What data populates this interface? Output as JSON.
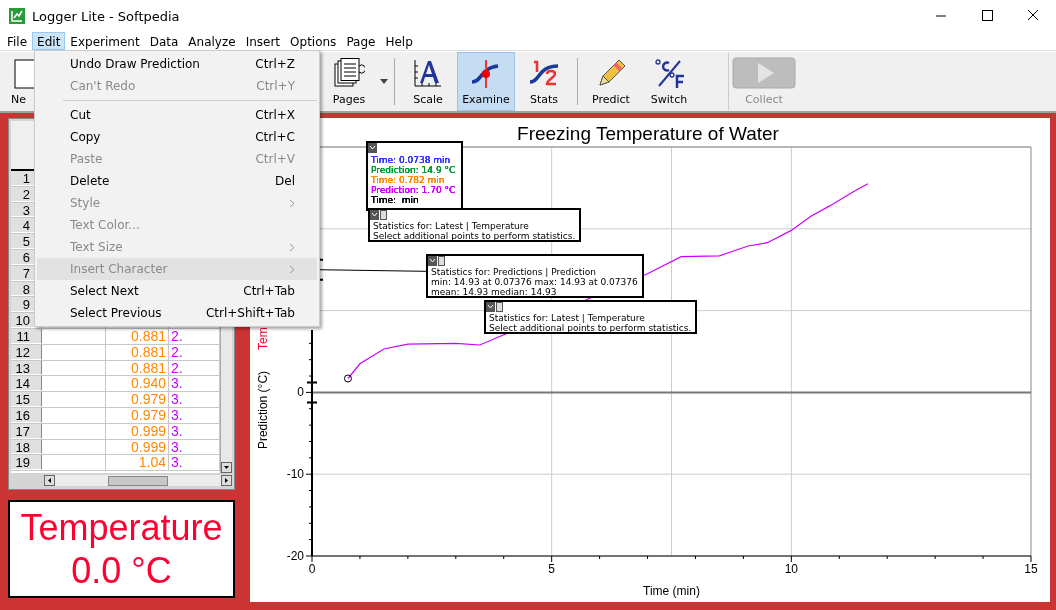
{
  "window": {
    "title": "Logger Lite - Softpedia"
  },
  "menu_bar": [
    {
      "label": "File",
      "selected": false
    },
    {
      "label": "Edit",
      "selected": true
    },
    {
      "label": "Experiment",
      "selected": false
    },
    {
      "label": "Data",
      "selected": false
    },
    {
      "label": "Analyze",
      "selected": false
    },
    {
      "label": "Insert",
      "selected": false
    },
    {
      "label": "Options",
      "selected": false
    },
    {
      "label": "Page",
      "selected": false
    },
    {
      "label": "Help",
      "selected": false
    }
  ],
  "toolbar": [
    {
      "label": "Ne",
      "kind": "new",
      "selected": false,
      "disabled": false
    },
    {
      "label": "Pages",
      "kind": "pages",
      "selected": false,
      "disabled": false
    },
    {
      "label": "Scale",
      "kind": "scale",
      "selected": false,
      "disabled": false
    },
    {
      "label": "Examine",
      "kind": "examine",
      "selected": true,
      "disabled": false
    },
    {
      "label": "Stats",
      "kind": "stats",
      "selected": false,
      "disabled": false
    },
    {
      "label": "Predict",
      "kind": "predict",
      "selected": false,
      "disabled": false
    },
    {
      "label": "Switch",
      "kind": "switch",
      "selected": false,
      "disabled": false
    },
    {
      "label": "Collect",
      "kind": "collect",
      "selected": false,
      "disabled": true
    }
  ],
  "edit_menu": [
    {
      "label": "Undo Draw Prediction",
      "shortcut": "Ctrl+Z",
      "disabled": false,
      "submenu": false,
      "highlighted": false
    },
    {
      "label": "Can't Redo",
      "shortcut": "Ctrl+Y",
      "disabled": true,
      "submenu": false,
      "highlighted": false,
      "separator_after": true
    },
    {
      "label": "Cut",
      "shortcut": "Ctrl+X",
      "disabled": false,
      "submenu": false,
      "highlighted": false
    },
    {
      "label": "Copy",
      "shortcut": "Ctrl+C",
      "disabled": false,
      "submenu": false,
      "highlighted": false
    },
    {
      "label": "Paste",
      "shortcut": "Ctrl+V",
      "disabled": true,
      "submenu": false,
      "highlighted": false
    },
    {
      "label": "Delete",
      "shortcut": "Del",
      "disabled": false,
      "submenu": false,
      "highlighted": false
    },
    {
      "label": "Style",
      "disabled": true,
      "submenu": true,
      "highlighted": false
    },
    {
      "label": "Text Color...",
      "disabled": true,
      "submenu": false,
      "highlighted": false
    },
    {
      "label": "Text Size",
      "disabled": true,
      "submenu": true,
      "highlighted": false
    },
    {
      "label": "Insert Character",
      "disabled": true,
      "submenu": true,
      "highlighted": true
    },
    {
      "label": "Select Next",
      "shortcut": "Ctrl+Tab",
      "disabled": false,
      "submenu": false,
      "highlighted": false
    },
    {
      "label": "Select Previous",
      "shortcut": "Ctrl+Shift+Tab",
      "disabled": false,
      "submenu": false,
      "highlighted": false
    }
  ],
  "table": {
    "rows": [
      {
        "number": "1"
      },
      {
        "number": "2"
      },
      {
        "number": "3"
      },
      {
        "number": "4"
      },
      {
        "number": "5"
      },
      {
        "number": "6"
      },
      {
        "number": "7"
      },
      {
        "number": "8"
      },
      {
        "number": "9"
      },
      {
        "number": "10"
      },
      {
        "number": "11",
        "column_2": "0.881",
        "column_3": "2."
      },
      {
        "number": "12",
        "column_2": "0.881",
        "column_3": "2."
      },
      {
        "number": "13",
        "column_2": "0.881",
        "column_3": "2."
      },
      {
        "number": "14",
        "column_2": "0.940",
        "column_3": "3."
      },
      {
        "number": "15",
        "column_2": "0.979",
        "column_3": "3."
      },
      {
        "number": "16",
        "column_2": "0.979",
        "column_3": "3."
      },
      {
        "number": "17",
        "column_2": "0.999",
        "column_3": "3."
      },
      {
        "number": "18",
        "column_2": "0.999",
        "column_3": "3."
      },
      {
        "number": "19",
        "column_2": "1.04",
        "column_3": "3."
      }
    ]
  },
  "meter": {
    "label": "Temperature",
    "reading": "0.0 °C"
  },
  "graph": {
    "y_label_cut": "Tem",
    "chart_data": {
      "type": "line",
      "title": "Freezing Temperature of Water",
      "xlabel": "Time (min)",
      "ylabel": "Prediction (°C)",
      "xlim": [
        0,
        15
      ],
      "ylim": [
        -20,
        30
      ],
      "xticks": [
        0,
        5,
        10,
        15
      ],
      "yticks": [
        -20,
        -10,
        0
      ],
      "grid": true,
      "x": [
        0.75,
        1.0,
        1.5,
        2.0,
        3.0,
        3.5,
        7.0,
        7.7,
        8.5,
        9.1,
        9.5,
        10.0,
        10.4,
        10.8,
        11.4,
        11.6
      ],
      "series": [
        {
          "color": "#cc00ff",
          "values": [
            1.7,
            3.5,
            5.3,
            5.9,
            6.0,
            5.8,
            14.5,
            16.6,
            16.7,
            17.9,
            18.3,
            19.8,
            21.5,
            22.8,
            24.9,
            25.5
          ]
        }
      ]
    },
    "examine_box": [
      {
        "text": "Time: 0.0738 min",
        "color": "#3333ff"
      },
      {
        "text": "Prediction: 14.9 °C",
        "color": "#009933"
      },
      {
        "text": "Time: 0.782 min",
        "color": "#ff8800"
      },
      {
        "text": "Prediction: 1.70 °C",
        "color": "#cc00ff"
      },
      {
        "text": "Time:  min",
        "color": "#000000"
      }
    ],
    "stats_boxes": [
      {
        "lines": [
          "Statistics for: Latest | Temperature",
          "Select additional points to perform statistics."
        ]
      },
      {
        "lines": [
          "Statistics for: Predictions | Prediction",
          "min: 14.93 at 0.07376 max: 14.93 at 0.07376",
          "mean: 14.93 median: 14.93"
        ]
      },
      {
        "lines": [
          "Statistics for: Latest | Temperature",
          "Select additional points to perform statistics."
        ]
      }
    ]
  }
}
